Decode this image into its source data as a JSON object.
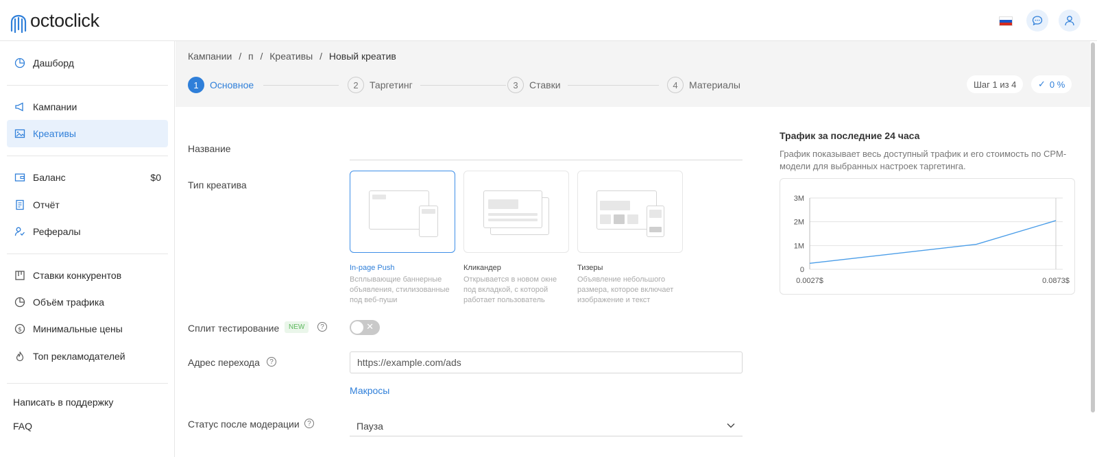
{
  "header": {
    "logo_text": "octoclick",
    "flag_icon": "russian-flag-icon",
    "chat_icon": "chat-icon",
    "user_icon": "user-icon",
    "flag_colors": [
      "#ffffff",
      "#1c57c7",
      "#d52b1e"
    ]
  },
  "sidebar": {
    "items": [
      {
        "label": "Дашборд",
        "icon": "dashboard-icon"
      },
      {
        "label": "Кампании",
        "icon": "megaphone-icon"
      },
      {
        "label": "Креативы",
        "icon": "image-icon",
        "active": true
      },
      {
        "label": "Баланс",
        "icon": "wallet-icon",
        "value": "$0"
      },
      {
        "label": "Отчёт",
        "icon": "report-icon"
      },
      {
        "label": "Рефералы",
        "icon": "referrals-icon"
      },
      {
        "label": "Ставки конкурентов",
        "icon": "bids-icon"
      },
      {
        "label": "Объём трафика",
        "icon": "traffic-icon"
      },
      {
        "label": "Минимальные цены",
        "icon": "dollar-icon"
      },
      {
        "label": "Топ рекламодателей",
        "icon": "fire-icon"
      }
    ],
    "support": "Написать в поддержку",
    "faq": "FAQ"
  },
  "breadcrumb": [
    "Кампании",
    "/",
    "п",
    "/",
    "Креативы",
    "/",
    "Новый креатив"
  ],
  "steps": [
    {
      "num": "1",
      "label": "Основное",
      "active": true
    },
    {
      "num": "2",
      "label": "Таргетинг"
    },
    {
      "num": "3",
      "label": "Ставки"
    },
    {
      "num": "4",
      "label": "Материалы"
    }
  ],
  "step_counter": "Шаг 1 из 4",
  "progress": "0 %",
  "form": {
    "name_label": "Название",
    "type_label": "Тип креатива",
    "types": [
      {
        "title": "In-page Push",
        "desc": "Всплывающие баннерные объявления, стилизованные под веб-пуши",
        "selected": true
      },
      {
        "title": "Кликандер",
        "desc": "Открывается в новом окне под вкладкой, с которой работает пользователь"
      },
      {
        "title": "Тизеры",
        "desc": "Объявление небольшого размера, которое включает изображение и текст"
      }
    ],
    "split_label": "Сплит тестирование",
    "split_badge": "NEW",
    "url_label": "Адрес перехода",
    "url_value": "https://example.com/ads",
    "macros_link": "Макросы",
    "status_label": "Статус после модерации",
    "status_value": "Пауза",
    "help_glyph": "?",
    "toggle_glyph": "✕"
  },
  "traffic": {
    "title": "Трафик за последние 24 часа",
    "desc": "График показывает весь доступный трафик и его стоимость по CPM-модели для выбранных настроек таргетинга."
  },
  "chart_data": {
    "type": "line",
    "title": "",
    "x_tick_labels": [
      "0.0027$",
      "0.0873$"
    ],
    "y_tick_labels": [
      "0",
      "1M",
      "2M",
      "3M"
    ],
    "xlim": [
      0.0027,
      0.0873
    ],
    "ylim": [
      0,
      3000000
    ],
    "x": [
      0.0027,
      0.06,
      0.0873
    ],
    "y": [
      250000,
      1050000,
      2050000
    ],
    "grid": true,
    "color": "#4a9de8"
  },
  "accent": "#2f7fd9"
}
